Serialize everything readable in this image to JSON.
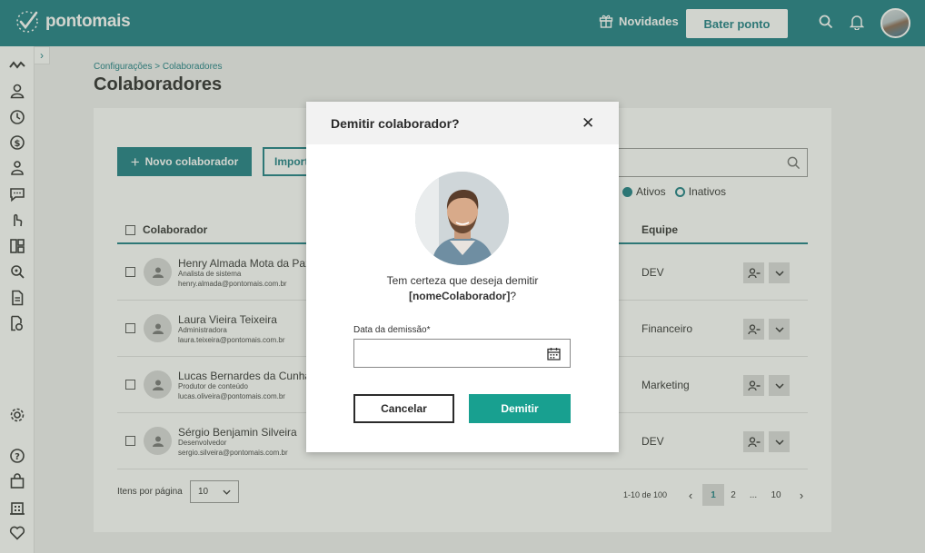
{
  "header": {
    "logo_text": "pontomais",
    "news_label": "Novidades",
    "punch_button": "Bater ponto"
  },
  "breadcrumb": "Configurações > Colaboradores",
  "page_title": "Colaboradores",
  "toolbar": {
    "new_button": "Novo colaborador",
    "import_button": "Importar",
    "filter_active": "Ativos",
    "filter_inactive": "Inativos"
  },
  "table": {
    "headers": {
      "collaborator": "Colaborador",
      "team": "Equipe"
    },
    "rows": [
      {
        "name": "Henry Almada Mota da Paz",
        "role": "Analista de sistema",
        "email": "henry.almada@pontomais.com.br",
        "team": "DEV"
      },
      {
        "name": "Laura Vieira Teixeira",
        "role": "Administradora",
        "email": "laura.teixeira@pontomais.com.br",
        "team": "Financeiro"
      },
      {
        "name": "Lucas Bernardes da Cunha",
        "role": "Produtor de conteúdo",
        "email": "lucas.oliveira@pontomais.com.br",
        "team": "Marketing"
      },
      {
        "name": "Sérgio Benjamin Silveira",
        "role": "Desenvolvedor",
        "email": "sergio.silveira@pontomais.com.br",
        "team": "DEV"
      }
    ]
  },
  "footer": {
    "per_page_label": "Itens por página",
    "per_page_value": "10",
    "range_info": "1-10 de 100",
    "pages": [
      "1",
      "2",
      "...",
      "10"
    ],
    "current_page": "1"
  },
  "modal": {
    "title": "Demitir colaborador?",
    "question_line1": "Tem certeza que deseja demitir",
    "question_name": "[nomeColaborador]",
    "question_suffix": "?",
    "date_label": "Data da demissão*",
    "cancel_button": "Cancelar",
    "confirm_button": "Demitir"
  },
  "colors": {
    "brand": "#1d7f85",
    "confirm": "#18a090"
  }
}
